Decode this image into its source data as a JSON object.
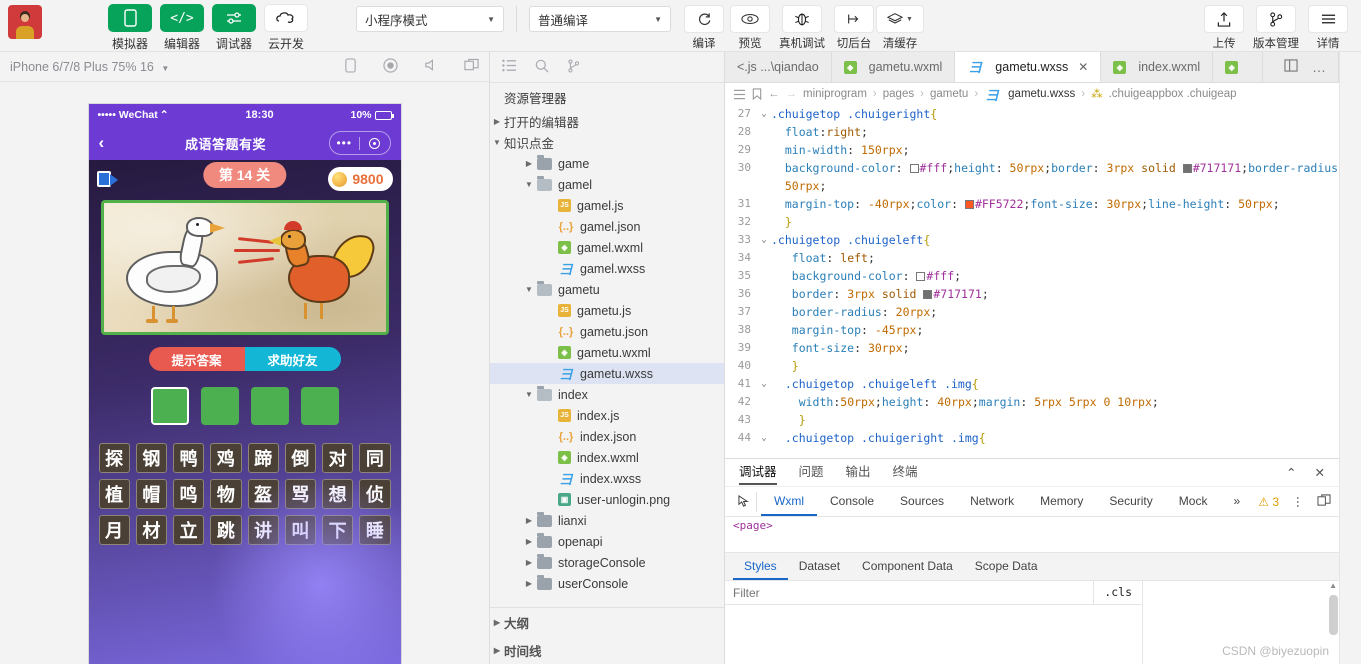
{
  "toolbar": {
    "mode_buttons": [
      {
        "label": "模拟器",
        "icon": "phone-icon",
        "style": "green"
      },
      {
        "label": "编辑器",
        "icon": "code-icon",
        "style": "green"
      },
      {
        "label": "调试器",
        "icon": "sliders-icon",
        "style": "green"
      },
      {
        "label": "云开发",
        "icon": "cloud-icon",
        "style": "white"
      }
    ],
    "mode_select": "小程序模式",
    "compile_select": "普通编译",
    "action_buttons": [
      {
        "label": "编译",
        "icon": "refresh-icon"
      },
      {
        "label": "预览",
        "icon": "eye-icon"
      },
      {
        "label": "真机调试",
        "icon": "bug-icon"
      },
      {
        "label": "切后台",
        "icon": "background-icon"
      },
      {
        "label": "清缓存",
        "icon": "layers-icon"
      }
    ],
    "right_buttons": [
      {
        "label": "上传",
        "icon": "upload-icon"
      },
      {
        "label": "版本管理",
        "icon": "branch-icon"
      },
      {
        "label": "详情",
        "icon": "menu-icon"
      }
    ]
  },
  "simulator": {
    "device": "iPhone 6/7/8 Plus 75% 16",
    "toolbar_icons": [
      "rotate-icon",
      "record-icon",
      "volume-icon",
      "window-icon"
    ],
    "status_bar": {
      "carrier": "••••• WeChat",
      "wifi": "⌃",
      "time": "18:30",
      "battery": "10%"
    },
    "nav": {
      "back": "‹",
      "title": "成语答题有奖",
      "capsule_dots": "•••"
    },
    "game": {
      "level_badge": "第 14 关",
      "coins": "9800",
      "buttons": [
        {
          "label": "提示答案",
          "color": "#e85a4f"
        },
        {
          "label": "求助好友",
          "color": "#14b6d6"
        }
      ],
      "answer_slots": 4,
      "grid_rows": [
        [
          "探",
          "钢",
          "鸭",
          "鸡",
          "蹄",
          "倒",
          "对",
          "同"
        ],
        [
          "植",
          "帽",
          "鸣",
          "物",
          "盔",
          "骂",
          "想",
          "侦"
        ],
        [
          "月",
          "材",
          "立",
          "跳",
          "讲",
          "叫",
          "下",
          "睡"
        ]
      ]
    }
  },
  "explorer": {
    "title": "资源管理器",
    "sections": [
      {
        "label": "打开的编辑器",
        "expanded": false
      },
      {
        "label": "知识点金",
        "expanded": true
      }
    ],
    "tree": [
      {
        "label": "game",
        "type": "folder",
        "indent": 1,
        "expanded": false
      },
      {
        "label": "gamel",
        "type": "folder-open",
        "indent": 1,
        "expanded": true
      },
      {
        "label": "gamel.js",
        "type": "js",
        "indent": 2
      },
      {
        "label": "gamel.json",
        "type": "json",
        "indent": 2
      },
      {
        "label": "gamel.wxml",
        "type": "wxml",
        "indent": 2
      },
      {
        "label": "gamel.wxss",
        "type": "wxss",
        "indent": 2
      },
      {
        "label": "gametu",
        "type": "folder-open",
        "indent": 1,
        "expanded": true
      },
      {
        "label": "gametu.js",
        "type": "js",
        "indent": 2
      },
      {
        "label": "gametu.json",
        "type": "json",
        "indent": 2
      },
      {
        "label": "gametu.wxml",
        "type": "wxml",
        "indent": 2
      },
      {
        "label": "gametu.wxss",
        "type": "wxss",
        "indent": 2,
        "selected": true
      },
      {
        "label": "index",
        "type": "folder-open",
        "indent": 1,
        "expanded": true
      },
      {
        "label": "index.js",
        "type": "js",
        "indent": 2
      },
      {
        "label": "index.json",
        "type": "json",
        "indent": 2
      },
      {
        "label": "index.wxml",
        "type": "wxml",
        "indent": 2
      },
      {
        "label": "index.wxss",
        "type": "wxss",
        "indent": 2
      },
      {
        "label": "user-unlogin.png",
        "type": "png",
        "indent": 2
      },
      {
        "label": "lianxi",
        "type": "folder",
        "indent": 1,
        "expanded": false
      },
      {
        "label": "openapi",
        "type": "folder",
        "indent": 1,
        "expanded": false
      },
      {
        "label": "storageConsole",
        "type": "folder",
        "indent": 1,
        "expanded": false
      },
      {
        "label": "userConsole",
        "type": "folder",
        "indent": 1,
        "expanded": false
      }
    ],
    "bottom_sections": [
      {
        "label": "大纲"
      },
      {
        "label": "时间线"
      }
    ]
  },
  "editor": {
    "tabs": [
      {
        "label": "<.js ...\\qiandao",
        "type": "js",
        "active": false,
        "truncated": true
      },
      {
        "label": "gametu.wxml",
        "type": "wxml",
        "active": false
      },
      {
        "label": "gametu.wxss",
        "type": "wxss",
        "active": true,
        "closable": true
      },
      {
        "label": "index.wxml",
        "type": "wxml",
        "active": false
      },
      {
        "label": "",
        "type": "wxml",
        "active": false
      }
    ],
    "breadcrumb": [
      "miniprogram",
      "pages",
      "gametu",
      "gametu.wxss",
      ".chuigeappbox .chuigeap"
    ],
    "code_lines": [
      {
        "num": 27,
        "fold": "v",
        "tokens": [
          {
            "t": ".chuigetop .chuigeright",
            "c": "sel"
          },
          {
            "t": "{",
            "c": "punc"
          }
        ]
      },
      {
        "num": 28,
        "fold": "",
        "tokens": [
          {
            "t": "  ",
            "c": "plain"
          },
          {
            "t": "float",
            "c": "prop"
          },
          {
            "t": ":",
            "c": "plain"
          },
          {
            "t": "right",
            "c": "val"
          },
          {
            "t": ";",
            "c": "plain"
          }
        ]
      },
      {
        "num": 29,
        "fold": "",
        "tokens": [
          {
            "t": "  ",
            "c": "plain"
          },
          {
            "t": "min-width",
            "c": "prop"
          },
          {
            "t": ": ",
            "c": "plain"
          },
          {
            "t": "150rpx",
            "c": "num"
          },
          {
            "t": ";",
            "c": "plain"
          }
        ]
      },
      {
        "num": 30,
        "fold": "",
        "tokens": [
          {
            "t": "  ",
            "c": "plain"
          },
          {
            "t": "background-color",
            "c": "prop"
          },
          {
            "t": ": ",
            "c": "plain"
          },
          {
            "t": "#fff",
            "c": "hex",
            "swatch": "#ffffff"
          },
          {
            "t": ";",
            "c": "plain"
          },
          {
            "t": "height",
            "c": "prop"
          },
          {
            "t": ": ",
            "c": "plain"
          },
          {
            "t": "50rpx",
            "c": "num"
          },
          {
            "t": ";",
            "c": "plain"
          },
          {
            "t": "border",
            "c": "prop"
          },
          {
            "t": ": ",
            "c": "plain"
          },
          {
            "t": "3rpx",
            "c": "num"
          },
          {
            "t": " solid ",
            "c": "val"
          },
          {
            "t": "#717171",
            "c": "hex",
            "swatch": "#717171"
          },
          {
            "t": ";",
            "c": "plain"
          },
          {
            "t": "border-radius",
            "c": "prop"
          },
          {
            "t": ":",
            "c": "plain"
          }
        ]
      },
      {
        "num": "",
        "fold": "",
        "tokens": [
          {
            "t": "  ",
            "c": "plain"
          },
          {
            "t": "50rpx",
            "c": "num"
          },
          {
            "t": ";",
            "c": "plain"
          }
        ]
      },
      {
        "num": 31,
        "fold": "",
        "tokens": [
          {
            "t": "  ",
            "c": "plain"
          },
          {
            "t": "margin-top",
            "c": "prop"
          },
          {
            "t": ": ",
            "c": "plain"
          },
          {
            "t": "-40rpx",
            "c": "num"
          },
          {
            "t": ";",
            "c": "plain"
          },
          {
            "t": "color",
            "c": "prop"
          },
          {
            "t": ": ",
            "c": "plain"
          },
          {
            "t": "#FF5722",
            "c": "hex",
            "swatch": "#FF5722"
          },
          {
            "t": ";",
            "c": "plain"
          },
          {
            "t": "font-size",
            "c": "prop"
          },
          {
            "t": ": ",
            "c": "plain"
          },
          {
            "t": "30rpx",
            "c": "num"
          },
          {
            "t": ";",
            "c": "plain"
          },
          {
            "t": "line-height",
            "c": "prop"
          },
          {
            "t": ": ",
            "c": "plain"
          },
          {
            "t": "50rpx",
            "c": "num"
          },
          {
            "t": ";",
            "c": "plain"
          }
        ]
      },
      {
        "num": 32,
        "fold": "",
        "tokens": [
          {
            "t": "  }",
            "c": "punc"
          }
        ]
      },
      {
        "num": 33,
        "fold": "v",
        "tokens": [
          {
            "t": ".chuigetop .chuigeleft",
            "c": "sel"
          },
          {
            "t": "{",
            "c": "punc"
          }
        ]
      },
      {
        "num": 34,
        "fold": "",
        "tokens": [
          {
            "t": "   ",
            "c": "plain"
          },
          {
            "t": "float",
            "c": "prop"
          },
          {
            "t": ": ",
            "c": "plain"
          },
          {
            "t": "left",
            "c": "val"
          },
          {
            "t": ";",
            "c": "plain"
          }
        ]
      },
      {
        "num": 35,
        "fold": "",
        "tokens": [
          {
            "t": "   ",
            "c": "plain"
          },
          {
            "t": "background-color",
            "c": "prop"
          },
          {
            "t": ": ",
            "c": "plain"
          },
          {
            "t": "#fff",
            "c": "hex",
            "swatch": "#ffffff"
          },
          {
            "t": ";",
            "c": "plain"
          }
        ]
      },
      {
        "num": 36,
        "fold": "",
        "tokens": [
          {
            "t": "   ",
            "c": "plain"
          },
          {
            "t": "border",
            "c": "prop"
          },
          {
            "t": ": ",
            "c": "plain"
          },
          {
            "t": "3rpx",
            "c": "num"
          },
          {
            "t": " solid ",
            "c": "val"
          },
          {
            "t": "#717171",
            "c": "hex",
            "swatch": "#717171"
          },
          {
            "t": ";",
            "c": "plain"
          }
        ]
      },
      {
        "num": 37,
        "fold": "",
        "tokens": [
          {
            "t": "   ",
            "c": "plain"
          },
          {
            "t": "border-radius",
            "c": "prop"
          },
          {
            "t": ": ",
            "c": "plain"
          },
          {
            "t": "20rpx",
            "c": "num"
          },
          {
            "t": ";",
            "c": "plain"
          }
        ]
      },
      {
        "num": 38,
        "fold": "",
        "tokens": [
          {
            "t": "   ",
            "c": "plain"
          },
          {
            "t": "margin-top",
            "c": "prop"
          },
          {
            "t": ": ",
            "c": "plain"
          },
          {
            "t": "-45rpx",
            "c": "num"
          },
          {
            "t": ";",
            "c": "plain"
          }
        ]
      },
      {
        "num": 39,
        "fold": "",
        "tokens": [
          {
            "t": "   ",
            "c": "plain"
          },
          {
            "t": "font-size",
            "c": "prop"
          },
          {
            "t": ": ",
            "c": "plain"
          },
          {
            "t": "30rpx",
            "c": "num"
          },
          {
            "t": ";",
            "c": "plain"
          }
        ]
      },
      {
        "num": 40,
        "fold": "",
        "tokens": [
          {
            "t": "   }",
            "c": "punc"
          }
        ]
      },
      {
        "num": 41,
        "fold": "v",
        "tokens": [
          {
            "t": "  .chuigetop .chuigeleft .img",
            "c": "sel"
          },
          {
            "t": "{",
            "c": "punc"
          }
        ]
      },
      {
        "num": 42,
        "fold": "",
        "tokens": [
          {
            "t": "    ",
            "c": "plain"
          },
          {
            "t": "width",
            "c": "prop"
          },
          {
            "t": ":",
            "c": "plain"
          },
          {
            "t": "50rpx",
            "c": "num"
          },
          {
            "t": ";",
            "c": "plain"
          },
          {
            "t": "height",
            "c": "prop"
          },
          {
            "t": ": ",
            "c": "plain"
          },
          {
            "t": "40rpx",
            "c": "num"
          },
          {
            "t": ";",
            "c": "plain"
          },
          {
            "t": "margin",
            "c": "prop"
          },
          {
            "t": ": ",
            "c": "plain"
          },
          {
            "t": "5rpx 5rpx 0 10rpx",
            "c": "num"
          },
          {
            "t": ";",
            "c": "plain"
          }
        ]
      },
      {
        "num": 43,
        "fold": "",
        "tokens": [
          {
            "t": "    }",
            "c": "punc"
          }
        ]
      },
      {
        "num": 44,
        "fold": "v",
        "tokens": [
          {
            "t": "  .chuigetop .chuigeright .img",
            "c": "sel"
          },
          {
            "t": "{",
            "c": "punc"
          }
        ]
      }
    ]
  },
  "debugger": {
    "panel_tabs": [
      {
        "label": "调试器",
        "active": true
      },
      {
        "label": "问题",
        "active": false
      },
      {
        "label": "输出",
        "active": false
      },
      {
        "label": "终端",
        "active": false
      }
    ],
    "devtool_tabs": [
      {
        "label": "Wxml",
        "active": true
      },
      {
        "label": "Console",
        "active": false
      },
      {
        "label": "Sources",
        "active": false
      },
      {
        "label": "Network",
        "active": false
      },
      {
        "label": "Memory",
        "active": false
      },
      {
        "label": "Security",
        "active": false
      },
      {
        "label": "Mock",
        "active": false
      }
    ],
    "more_tabs": "»",
    "warning_count": "3",
    "wxml_snippet": "<page>",
    "style_tabs": [
      {
        "label": "Styles",
        "active": true
      },
      {
        "label": "Dataset",
        "active": false
      },
      {
        "label": "Component Data",
        "active": false
      },
      {
        "label": "Scope Data",
        "active": false
      }
    ],
    "filter_placeholder": "Filter",
    "cls_button": ".cls"
  },
  "watermark": "CSDN @biyezuopin"
}
